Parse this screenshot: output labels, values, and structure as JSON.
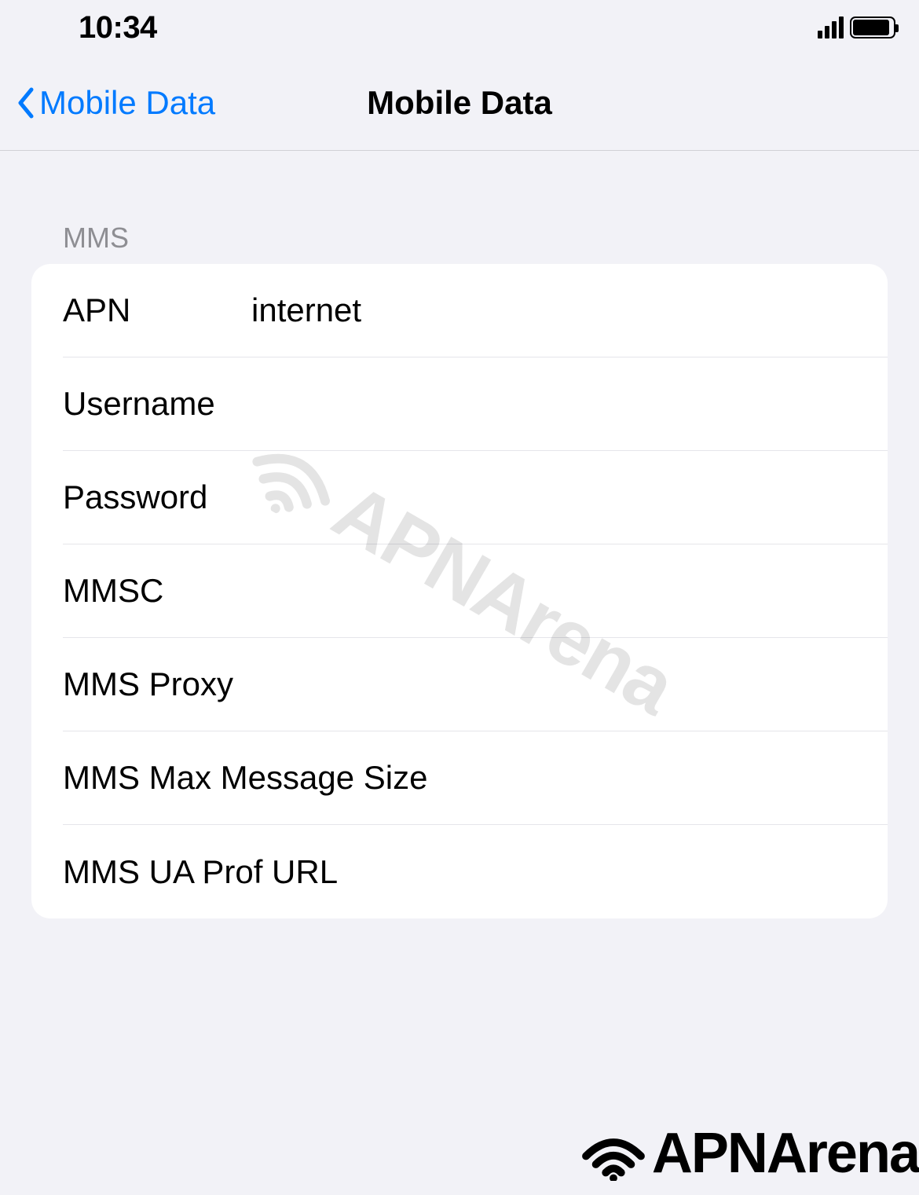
{
  "status": {
    "time": "10:34"
  },
  "nav": {
    "back_label": "Mobile Data",
    "title": "Mobile Data"
  },
  "section": {
    "header": "MMS"
  },
  "fields": {
    "apn": {
      "label": "APN",
      "value": "internet"
    },
    "username": {
      "label": "Username",
      "value": ""
    },
    "password": {
      "label": "Password",
      "value": ""
    },
    "mmsc": {
      "label": "MMSC",
      "value": ""
    },
    "mms_proxy": {
      "label": "MMS Proxy",
      "value": ""
    },
    "mms_max": {
      "label": "MMS Max Message Size",
      "value": ""
    },
    "mms_ua": {
      "label": "MMS UA Prof URL",
      "value": ""
    }
  },
  "watermark": {
    "text": "APNArena"
  },
  "footer": {
    "brand": "APNArena"
  }
}
